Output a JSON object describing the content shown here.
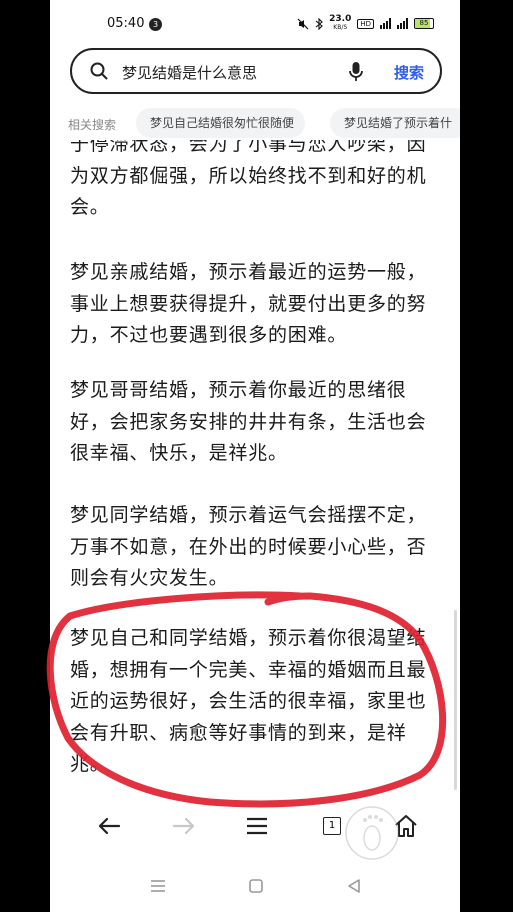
{
  "status_bar": {
    "time": "05:40",
    "notification_count": "3",
    "net_speed_value": "23.0",
    "net_speed_unit": "KB/S",
    "hd_label": "HD",
    "battery": "85"
  },
  "search": {
    "query": "梦见结婚是什么意思",
    "button_label": "搜索"
  },
  "related": {
    "label": "相关搜索",
    "chips": [
      "梦见自己结婚很匆忙很随便",
      "梦见结婚了预示着什"
    ]
  },
  "article": {
    "paragraphs": [
      "于停滞状态，会为了小事与恋人吵架，因为双方都倔强，所以始终找不到和好的机会。",
      "梦见亲戚结婚，预示着最近的运势一般，事业上想要获得提升，就要付出更多的努力，不过也要遇到很多的困难。",
      "梦见哥哥结婚，预示着你最近的思绪很好，会把家务安排的井井有条，生活也会很幸福、快乐，是祥兆。",
      "梦见同学结婚，预示着运气会摇摆不定，万事不如意，在外出的时候要小心些，否则会有火灾发生。",
      "梦见自己和同学结婚，预示着你很渴望结婚，想拥有一个完美、幸福的婚姻而且最近的运势很好，会生活的很幸福，家里也会有升职、病愈等好事情的到来，是祥兆。"
    ]
  },
  "toolbar": {
    "tabs_count": "1"
  },
  "colors": {
    "accent": "#2f5fe8",
    "annotation": "#e0202f"
  }
}
